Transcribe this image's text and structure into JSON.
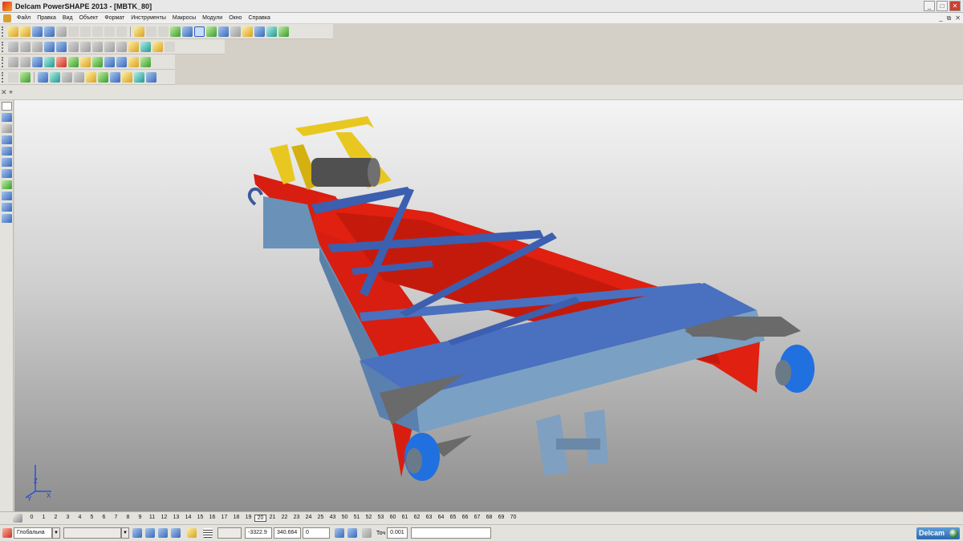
{
  "window": {
    "title": "Delcam PowerSHAPE 2013 - [MBTK_80]",
    "minimize": "_",
    "maximize": "□",
    "close": "✕"
  },
  "menu": {
    "items": [
      "Файл",
      "Правка",
      "Вид",
      "Объект",
      "Формат",
      "Инструменты",
      "Макросы",
      "Модули",
      "Окно",
      "Справка"
    ],
    "doc_controls": [
      "_",
      "⧉",
      "✕"
    ]
  },
  "levels": {
    "values": [
      "0",
      "1",
      "2",
      "3",
      "4",
      "5",
      "6",
      "7",
      "8",
      "9",
      "11",
      "12",
      "13",
      "14",
      "15",
      "16",
      "17",
      "18",
      "19",
      "20",
      "21",
      "22",
      "23",
      "24",
      "25",
      "43",
      "50",
      "51",
      "52",
      "53",
      "60",
      "61",
      "62",
      "63",
      "64",
      "65",
      "66",
      "67",
      "68",
      "69",
      "70"
    ],
    "active": "20"
  },
  "status": {
    "workplane": "Глобальна",
    "x": "-3322.9",
    "y": "340.664",
    "z": "0",
    "tolerance_label": "Точ",
    "tolerance": "0.001",
    "brand": "Delcam"
  },
  "axis": {
    "z": "Z",
    "y": "Y",
    "x": "X"
  },
  "colors": {
    "frame_red": "#e02010",
    "beam_blue": "#4a70c0",
    "steel_light": "#6a92b8",
    "yoke_yellow": "#e8c820",
    "plate_gray": "#6a6a6a",
    "wheel_blue": "#2070e0"
  }
}
